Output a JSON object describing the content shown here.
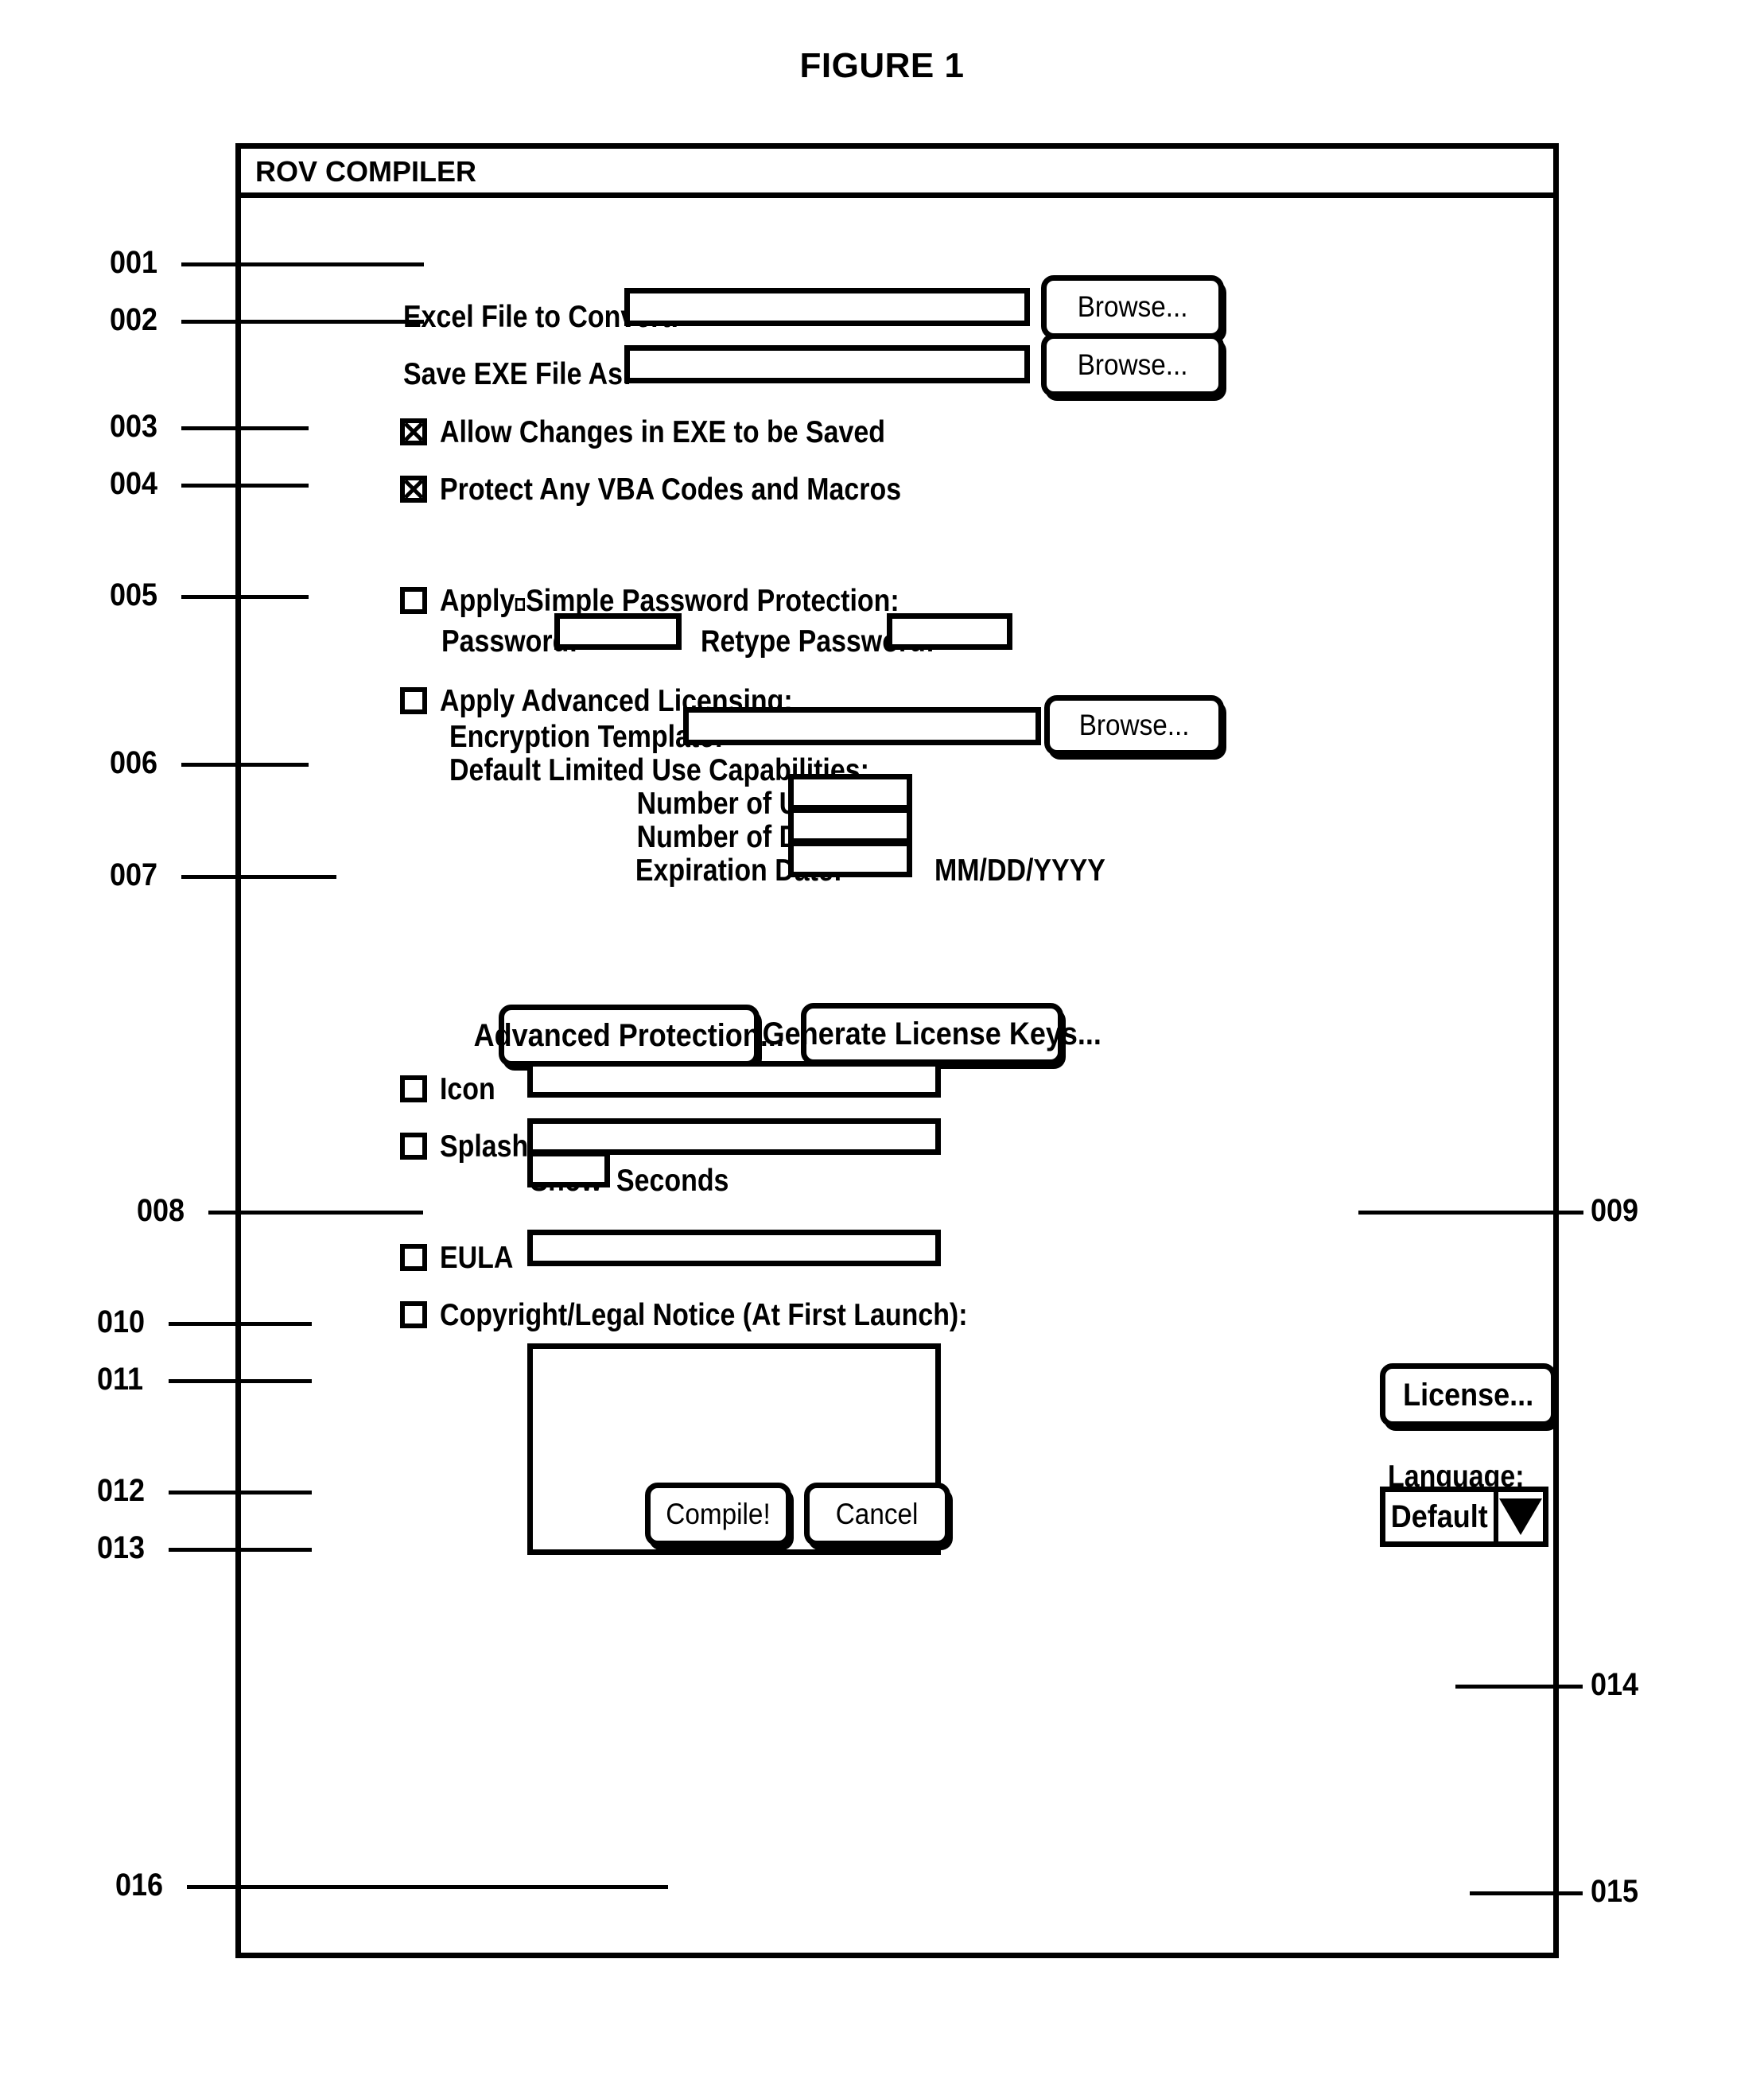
{
  "figure": {
    "title": "FIGURE 1"
  },
  "dialog": {
    "title": "ROV COMPILER"
  },
  "fields": {
    "excel_file_label": "Excel File to Convert:",
    "excel_file_value": "",
    "save_exe_label": "Save EXE File As:",
    "save_exe_value": "",
    "browse_label": "Browse...",
    "password_label": "Password:",
    "password_value": "",
    "retype_password_label": "Retype Password:",
    "retype_password_value": "",
    "encryption_template_label": "Encryption Template:",
    "encryption_template_value": "",
    "number_of_uses_label": "Number of Uses:",
    "number_of_uses_value": "",
    "number_of_days_label": "Number of Days:",
    "number_of_days_value": "",
    "expiration_date_label": "Expiration Date:",
    "expiration_date_value": "",
    "expiration_date_format": "MM/DD/YYYY",
    "icon_value": "",
    "splash_value": "",
    "show_label": "Show",
    "show_seconds_value": "",
    "seconds_label": "Seconds",
    "eula_value": "",
    "legal_notice_value": ""
  },
  "checkboxes": {
    "allow_changes": {
      "label": "Allow Changes in EXE to be Saved",
      "checked": true
    },
    "protect_vba": {
      "label": "Protect Any VBA Codes and Macros",
      "checked": true
    },
    "simple_password": {
      "label_a": "Apply",
      "label_b": "Simple Password Protection:",
      "checked": false
    },
    "advanced_licensing": {
      "label": "Apply Advanced Licensing:",
      "checked": false
    },
    "icon": {
      "label": "Icon",
      "checked": false
    },
    "splash": {
      "label": "Splash",
      "checked": false
    },
    "eula": {
      "label": "EULA",
      "checked": false
    },
    "copyright_notice": {
      "label": "Copyright/Legal Notice (At First Launch):",
      "checked": false
    }
  },
  "section_headings": {
    "default_limited_use": "Default Limited Use Capabilities:"
  },
  "buttons": {
    "advanced_protection": "Advanced Protection...",
    "generate_license_keys": "Generate License Keys...",
    "license": "License...",
    "compile": "Compile!",
    "cancel": "Cancel"
  },
  "language": {
    "label": "Language:",
    "selected": "Default"
  },
  "reference_numerals": {
    "n001": "001",
    "n002": "002",
    "n003": "003",
    "n004": "004",
    "n005": "005",
    "n006": "006",
    "n007": "007",
    "n008": "008",
    "n009": "009",
    "n010": "010",
    "n011": "011",
    "n012": "012",
    "n013": "013",
    "n014": "014",
    "n015": "015",
    "n016": "016"
  },
  "colors": {
    "ink": "#000000",
    "paper": "#ffffff"
  }
}
